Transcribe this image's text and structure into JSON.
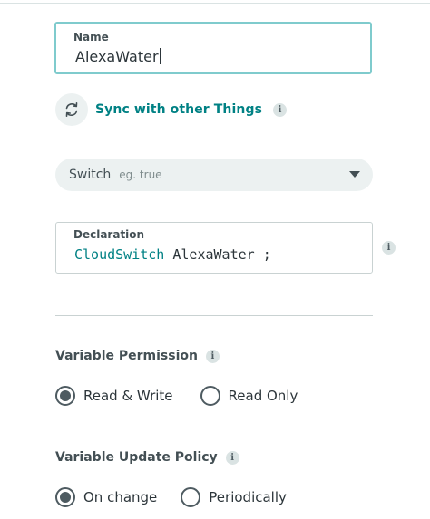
{
  "name_field": {
    "label": "Name",
    "value": "AlexaWater"
  },
  "sync": {
    "label": "Sync with other Things",
    "icon": "sync-icon"
  },
  "type_select": {
    "value": "Switch",
    "hint": "eg. true"
  },
  "declaration": {
    "label": "Declaration",
    "type": "CloudSwitch",
    "name": "AlexaWater",
    "terminator": ";"
  },
  "permission": {
    "title": "Variable Permission",
    "options": [
      {
        "label": "Read & Write",
        "selected": true
      },
      {
        "label": "Read Only",
        "selected": false
      }
    ]
  },
  "update_policy": {
    "title": "Variable Update Policy",
    "options": [
      {
        "label": "On change",
        "selected": true
      },
      {
        "label": "Periodically",
        "selected": false
      }
    ]
  },
  "info_glyph": "i",
  "colors": {
    "accent": "#008184",
    "focus_border": "#7fcbcd",
    "field_bg": "#ecf1f1",
    "text": "#434f54"
  }
}
